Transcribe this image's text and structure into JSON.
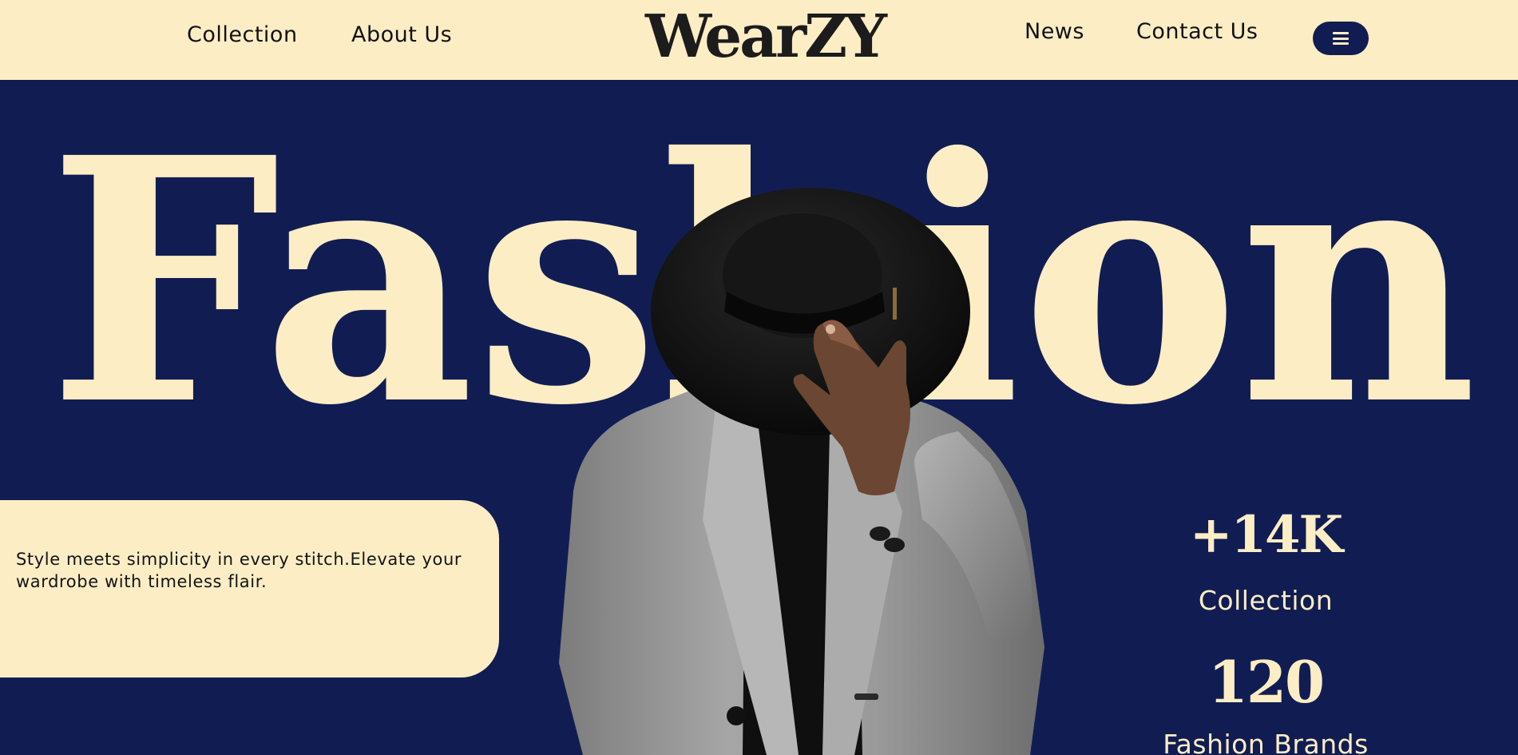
{
  "header": {
    "nav_left": [
      {
        "label": "Collection"
      },
      {
        "label": "About Us"
      }
    ],
    "logo_text": "WearZY",
    "nav_right": [
      {
        "label": "News"
      },
      {
        "label": "Contact Us"
      }
    ],
    "menu_icon": "hamburger-menu-icon"
  },
  "hero": {
    "title": "Fashion"
  },
  "intro": {
    "text": "Style meets simplicity in every stitch.Elevate your wardrobe with timeless flair."
  },
  "stats": [
    {
      "value": "+14K",
      "label": "Collection"
    },
    {
      "value": "120",
      "label": "Fashion Brands"
    }
  ],
  "colors": {
    "navy": "#111d52",
    "cream": "#fcedc5",
    "ink": "#141414"
  }
}
